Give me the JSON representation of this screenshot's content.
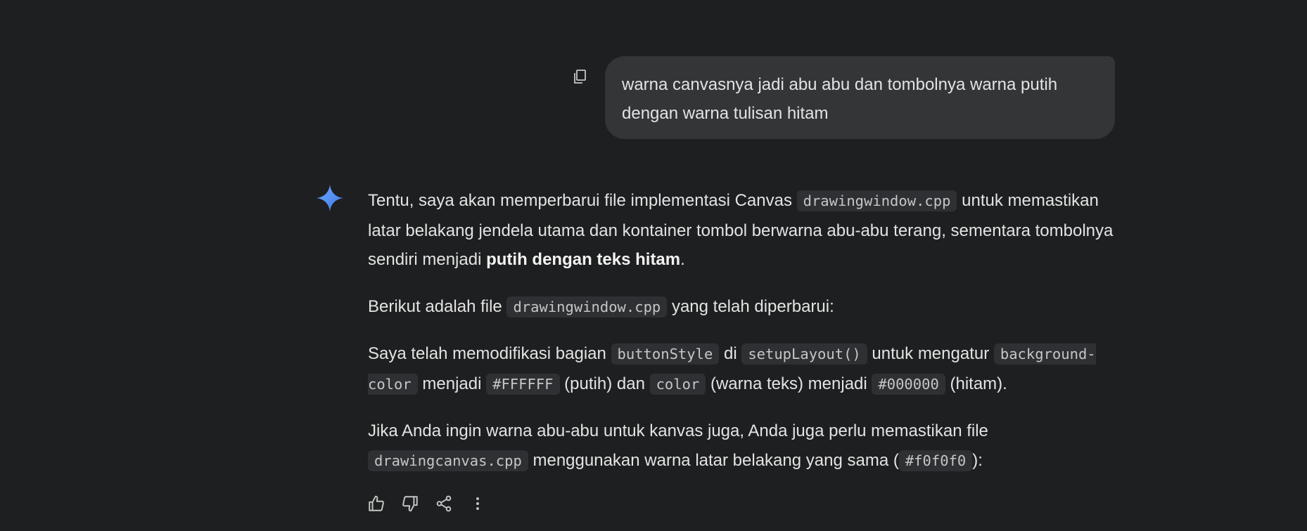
{
  "colors": {
    "background": "#1e1f20",
    "bubble": "#333537",
    "text": "#e3e3e3",
    "code_bg": "#2e3033",
    "code_text": "#c4c7c5",
    "sparkle": "#4b8df8"
  },
  "user_message": {
    "copy_icon": "copy-icon",
    "text": "warna canvasnya jadi abu abu dan tombolnya warna putih dengan warna tulisan hitam"
  },
  "response": {
    "icon": "gemini-sparkle-icon",
    "p1": {
      "t1": "Tentu, saya akan memperbarui file implementasi Canvas ",
      "c1": "drawingwindow.cpp",
      "t2": " untuk memastikan latar belakang jendela utama dan kontainer tombol berwarna abu-abu terang, sementara tombolnya sendiri menjadi ",
      "bold": "putih dengan teks hitam",
      "t3": "."
    },
    "p2": {
      "t1": "Berikut adalah file ",
      "c1": "drawingwindow.cpp",
      "t2": " yang telah diperbarui:"
    },
    "p3": {
      "t1": "Saya telah memodifikasi bagian ",
      "c1": "buttonStyle",
      "t2": " di ",
      "c2": "setupLayout()",
      "t3": " untuk mengatur ",
      "c3": "background-color",
      "t4": " menjadi ",
      "c4": "#FFFFFF",
      "t5": " (putih) dan ",
      "c5": "color",
      "t6": " (warna teks) menjadi ",
      "c6": "#000000",
      "t7": " (hitam)."
    },
    "p4": {
      "t1": "Jika Anda ingin warna abu-abu untuk kanvas juga, Anda juga perlu memastikan file ",
      "c1": "drawingcanvas.cpp",
      "t2": " menggunakan warna latar belakang yang sama (",
      "c2": "#f0f0f0",
      "t3": "):"
    }
  },
  "actions": {
    "icons": [
      "thumbs-up-icon",
      "thumbs-down-icon",
      "share-icon",
      "more-vert-icon"
    ]
  }
}
